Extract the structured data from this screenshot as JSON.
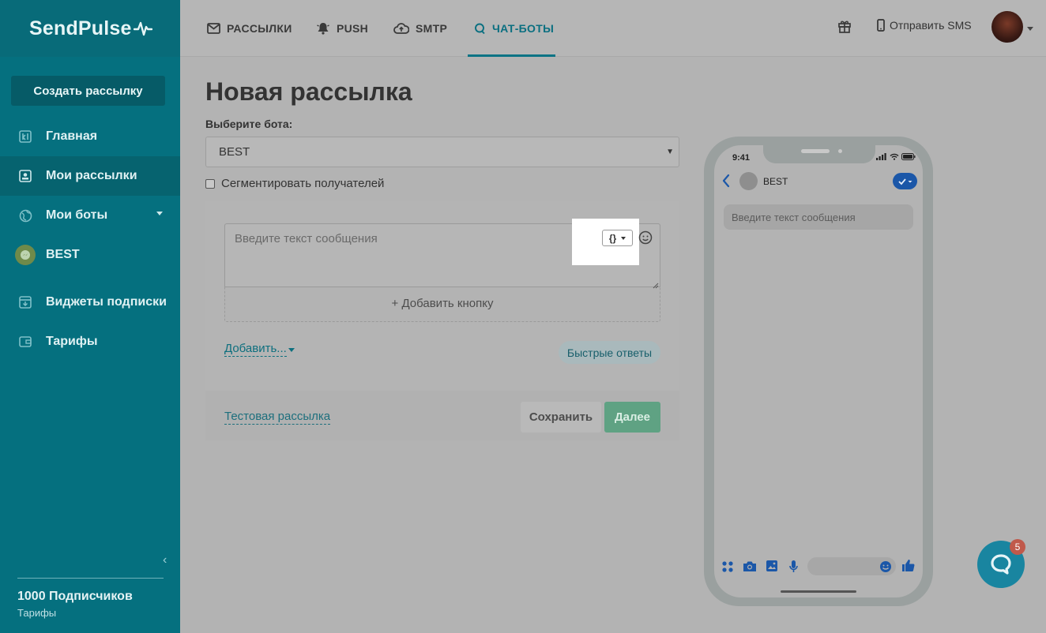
{
  "app": {
    "logo": "SendPulse"
  },
  "sidebar": {
    "create_button": "Создать рассылку",
    "items": [
      {
        "label": "Главная"
      },
      {
        "label": "Мои рассылки"
      },
      {
        "label": "Мои боты"
      },
      {
        "label": "BEST"
      },
      {
        "label": "Виджеты подписки"
      },
      {
        "label": "Тарифы"
      }
    ],
    "subscribers": "1000 Подписчиков",
    "tariffs_link": "Тарифы"
  },
  "topbar": {
    "tabs": [
      {
        "label": "РАССЫЛКИ"
      },
      {
        "label": "PUSH"
      },
      {
        "label": "SMTP"
      },
      {
        "label": "ЧАТ-БОТЫ"
      }
    ],
    "send_sms": "Отправить SMS"
  },
  "main": {
    "title": "Новая рассылка",
    "bot_label": "Выберите бота:",
    "bot_selected": "BEST",
    "segment_label": "Сегментировать получателей",
    "message_placeholder": "Введите текст сообщения",
    "var_button": "{}",
    "add_button": "+ Добавить кнопку",
    "add_more": "Добавить...",
    "quick_replies": "Быстрые ответы",
    "test_link": "Тестовая рассылка",
    "save": "Сохранить",
    "next": "Далее"
  },
  "preview": {
    "time": "9:41",
    "bot_name": "BEST",
    "message_placeholder": "Введите текст сообщения"
  },
  "chat_widget": {
    "badge": "5"
  },
  "colors": {
    "sidebar": "#05707f",
    "accent": "#0a7385",
    "next_button": "#5fa283",
    "messenger_blue": "#1b57a8"
  }
}
